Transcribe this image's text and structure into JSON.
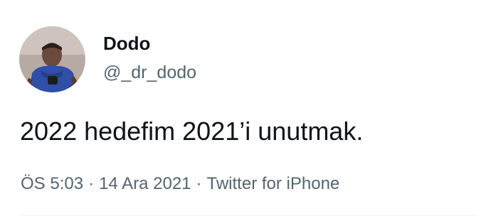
{
  "author": {
    "display_name": "Dodo",
    "handle": "@_dr_dodo"
  },
  "tweet": {
    "text": "2022 hedefim 2021’i unutmak."
  },
  "meta": {
    "time": "ÖS 5:03",
    "separator": "·",
    "date": "14 Ara 2021",
    "source": "Twitter for iPhone"
  },
  "colors": {
    "text_primary": "#0f1419",
    "text_secondary": "#536471",
    "divider": "#eff3f4"
  }
}
